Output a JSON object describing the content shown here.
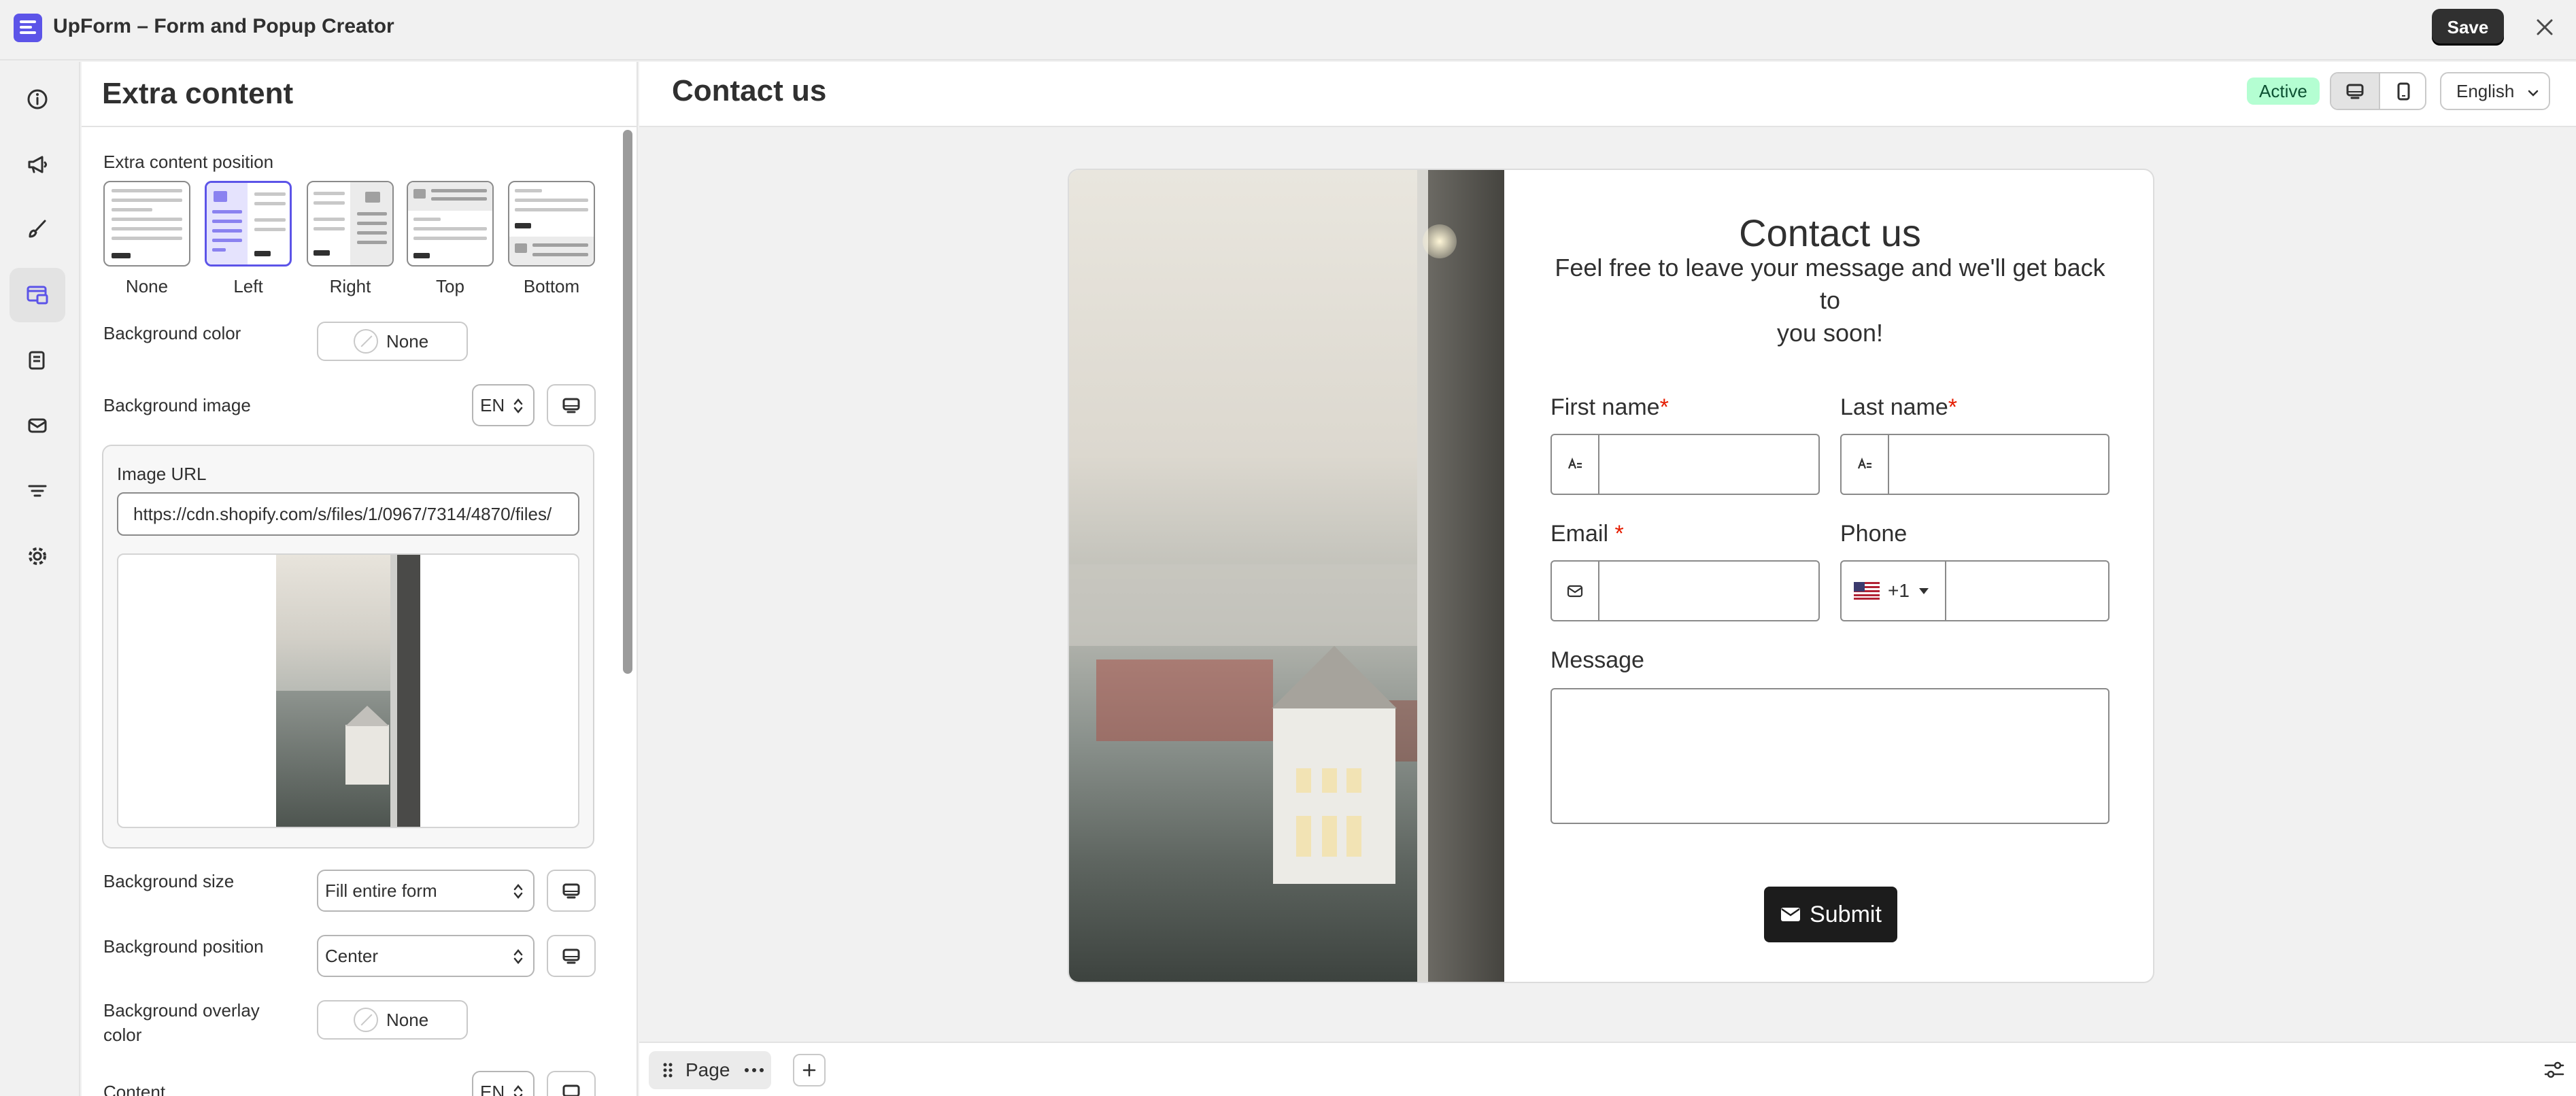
{
  "app": {
    "title": "UpForm – Form and Popup Creator",
    "save_label": "Save"
  },
  "rail": {
    "items": [
      {
        "name": "info-icon",
        "active": false
      },
      {
        "name": "megaphone-icon",
        "active": false
      },
      {
        "name": "paintbrush-icon",
        "active": false
      },
      {
        "name": "extra-content-icon",
        "active": true
      },
      {
        "name": "form-fields-icon",
        "active": false
      },
      {
        "name": "email-icon",
        "active": false
      },
      {
        "name": "filter-icon",
        "active": false
      },
      {
        "name": "settings-icon",
        "active": false
      }
    ]
  },
  "panel": {
    "title": "Extra content",
    "position_label": "Extra content position",
    "positions": [
      {
        "label": "None",
        "selected": false
      },
      {
        "label": "Left",
        "selected": true
      },
      {
        "label": "Right",
        "selected": false
      },
      {
        "label": "Top",
        "selected": false
      },
      {
        "label": "Bottom",
        "selected": false
      }
    ],
    "bg_color_label": "Background color",
    "bg_color_value": "None",
    "bg_image_label": "Background image",
    "bg_image_lang": "EN",
    "image_url_label": "Image URL",
    "image_url_value": "https://cdn.shopify.com/s/files/1/0967/7314/4870/files/",
    "bg_size_label": "Background size",
    "bg_size_value": "Fill entire form",
    "bg_position_label": "Background position",
    "bg_position_value": "Center",
    "bg_overlay_label_1": "Background overlay",
    "bg_overlay_label_2": "color",
    "bg_overlay_value": "None",
    "content_label": "Content",
    "content_lang": "EN"
  },
  "canvas": {
    "title": "Contact us",
    "status": "Active",
    "language": "English"
  },
  "form": {
    "title": "Contact us",
    "subtitle_line1": "Feel free to leave your message and we'll get back to",
    "subtitle_line2": "you soon!",
    "first_name_label": "First name",
    "last_name_label": "Last name",
    "email_label": "Email",
    "phone_label": "Phone",
    "phone_code": "+1",
    "message_label": "Message",
    "required_mark": "*",
    "submit_label": "Submit"
  },
  "bottom": {
    "page_label": "Page"
  },
  "colors": {
    "accent": "#5c54e8",
    "active_badge": "#b4fed2",
    "required": "#e51c00"
  }
}
